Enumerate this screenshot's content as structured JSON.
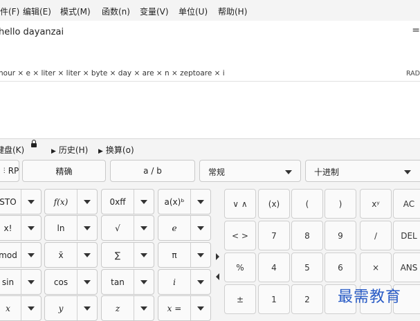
{
  "menu": [
    "文件(F)",
    "编辑(E)",
    "模式(M)",
    "函数(n)",
    "变量(V)",
    "单位(U)",
    "帮助(H)"
  ],
  "expression": "hello dayanzai",
  "status_parsed": "hour × e × liter × liter × byte × day × are × n × zeptoare × i",
  "angle_mode": "RAD",
  "tabs": {
    "keypad": "键盘(K)",
    "history": "历史(H)",
    "convert": "换算(o)"
  },
  "toolbar": {
    "rpn": "RP",
    "exact": "精确",
    "fraction": "a / b",
    "mode": "常规",
    "base": "十进制"
  },
  "func_rows": [
    [
      "STO",
      "f(x)",
      "0xff",
      "a(x)ᵇ"
    ],
    [
      "x!",
      "ln",
      "√",
      "e"
    ],
    [
      "mod",
      "x̄",
      "∑",
      "π"
    ],
    [
      "sin",
      "cos",
      "tan",
      "i"
    ],
    [
      "x",
      "y",
      "z",
      "x ="
    ]
  ],
  "pad_rows": [
    [
      "(x)",
      "(",
      ")",
      "xʸ",
      "AC"
    ],
    [
      "7",
      "8",
      "9",
      "∕",
      "DEL"
    ],
    [
      "4",
      "5",
      "6",
      "×",
      "ANS"
    ],
    [
      "1",
      "2",
      "",
      "",
      ""
    ]
  ],
  "nav_buttons": [
    "∨ ∧",
    "< >",
    "%",
    "±"
  ],
  "watermark": "最需教育"
}
